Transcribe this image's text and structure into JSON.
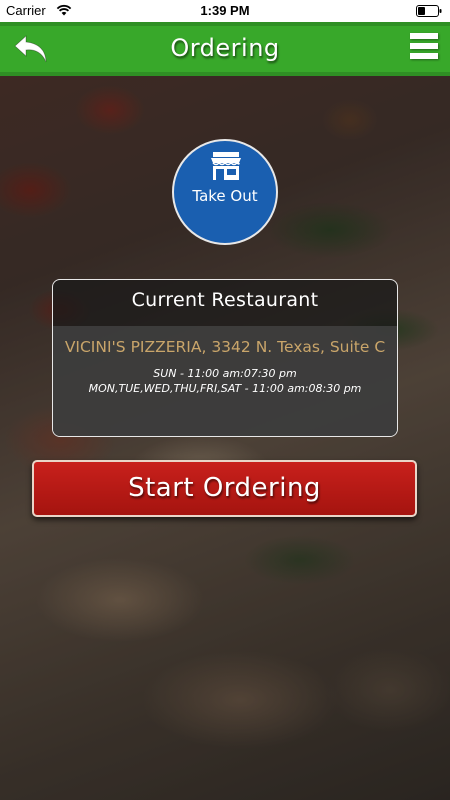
{
  "status_bar": {
    "carrier": "Carrier",
    "time": "1:39 PM"
  },
  "header": {
    "title": "Ordering",
    "back_icon": "back-arrow-icon",
    "menu_icon": "hamburger-menu-icon",
    "color": "#38a82a"
  },
  "order_type": {
    "label": "Take Out",
    "icon": "storefront-icon",
    "color": "#1a5fb0"
  },
  "restaurant_card": {
    "title": "Current Restaurant",
    "name": "VICINI'S PIZZERIA, 3342 N. Texas, Suite C",
    "hours": [
      "SUN - 11:00 am:07:30 pm",
      "MON,TUE,WED,THU,FRI,SAT - 11:00 am:08:30 pm"
    ],
    "name_color": "#c9a56a"
  },
  "actions": {
    "start_ordering_label": "Start Ordering",
    "start_ordering_color": "#c8201c"
  }
}
